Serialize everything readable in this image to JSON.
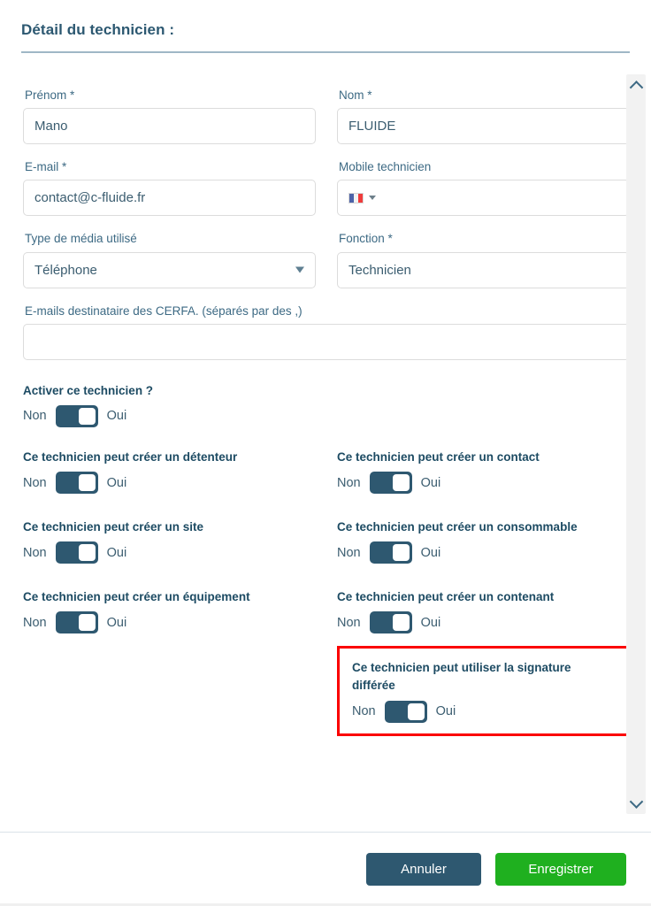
{
  "header": {
    "title": "Détail du technicien :"
  },
  "form": {
    "firstname": {
      "label": "Prénom *",
      "value": "Mano"
    },
    "lastname": {
      "label": "Nom *",
      "value": "FLUIDE"
    },
    "email": {
      "label": "E-mail *",
      "value": "contact@c-fluide.fr"
    },
    "mobile": {
      "label": "Mobile technicien",
      "value": "",
      "country_flag": "france-flag-icon"
    },
    "media_type": {
      "label": "Type de média utilisé",
      "value": "Téléphone",
      "options": [
        "Téléphone"
      ]
    },
    "role": {
      "label": "Fonction *",
      "value": "Technicien"
    },
    "cerfa_emails": {
      "label": "E-mails destinataire des CERFA. (séparés par des ,)",
      "value": ""
    }
  },
  "toggles": {
    "off_label": "Non",
    "on_label": "Oui",
    "activate": {
      "label": "Activer ce technicien ?",
      "state": "Oui"
    },
    "permissions": [
      {
        "label": "Ce technicien peut créer un détenteur",
        "state": "Oui"
      },
      {
        "label": "Ce technicien peut créer un contact",
        "state": "Oui"
      },
      {
        "label": "Ce technicien peut créer un site",
        "state": "Oui"
      },
      {
        "label": "Ce technicien peut créer un consommable",
        "state": "Oui"
      },
      {
        "label": "Ce technicien peut créer un équipement",
        "state": "Oui"
      },
      {
        "label": "Ce technicien peut créer un contenant",
        "state": "Oui"
      }
    ],
    "highlighted": {
      "label": "Ce technicien peut utiliser la signature différée",
      "state": "Oui",
      "highlight_color": "#fb0000"
    }
  },
  "scrollbar": {
    "up_icon": "chevron-up-icon",
    "down_icon": "chevron-down-icon"
  },
  "footer": {
    "cancel_label": "Annuler",
    "save_label": "Enregistrer",
    "cancel_color": "#2e5870",
    "save_color": "#1fb01f"
  },
  "theme": {
    "title_color": "#2c5871",
    "label_color": "#3d6a84",
    "toggle_on_color": "#2e5870"
  }
}
